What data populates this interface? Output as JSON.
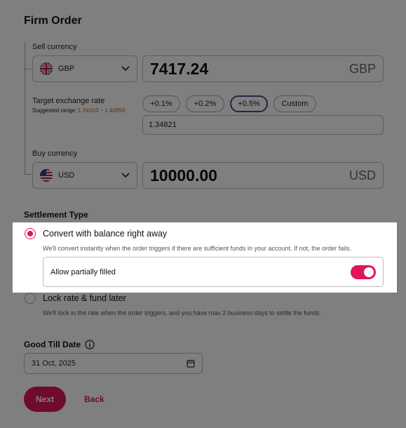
{
  "form": {
    "title": "Firm Order"
  },
  "sell": {
    "label": "Sell currency",
    "currency": "GBP",
    "flag_icon": "uk-flag-icon",
    "amount": "7417.24",
    "amount_currency": "GBP"
  },
  "rate": {
    "label": "Target exchange rate",
    "suggested_prefix": "Suggested range:",
    "suggested_value": "1.34163 ~ 1.40858",
    "chips": [
      "+0.1%",
      "+0.2%",
      "+0.5%",
      "Custom"
    ],
    "selected_chip": "+0.5%",
    "value": "1.34821"
  },
  "buy": {
    "label": "Buy currency",
    "currency": "USD",
    "flag_icon": "us-flag-icon",
    "amount": "10000.00",
    "amount_currency": "USD"
  },
  "settlement": {
    "title": "Settlement Type",
    "options": [
      {
        "label": "Convert with balance right away",
        "description": "We'll convert instantly when the order triggers if there are sufficient funds in your account. If not, the order fails.",
        "selected": true
      },
      {
        "label": "Lock rate & fund later",
        "description": "We'll lock in the rate when the order triggers, and you have max 2 business days to settle the funds.",
        "selected": false
      }
    ],
    "partial": {
      "label": "Allow partially filled",
      "enabled": true
    }
  },
  "gtd": {
    "title": "Good Till Date",
    "value": "31 Oct, 2025"
  },
  "actions": {
    "next_label": "Next",
    "back_label": "Back"
  },
  "colors": {
    "accent": "#e0155e",
    "overlay": "rgba(0,0,0,0.5)"
  }
}
